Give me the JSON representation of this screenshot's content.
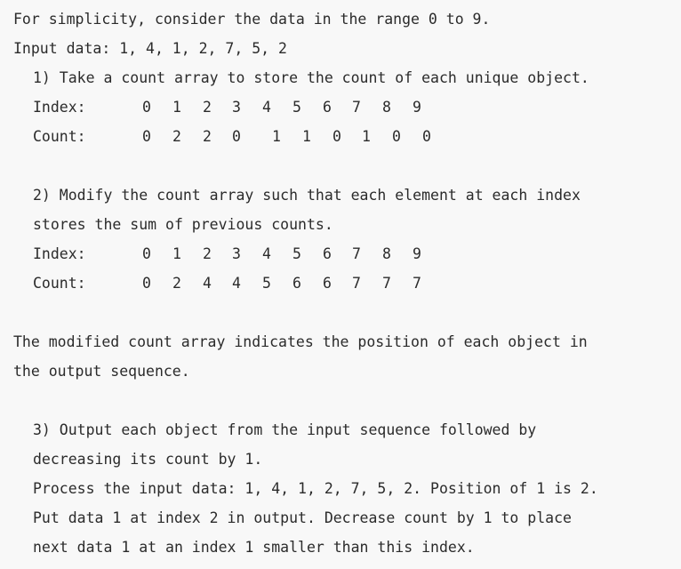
{
  "intro": {
    "line1": "For simplicity, consider the data in the range 0 to 9.",
    "line2": "Input data: 1, 4, 1, 2, 7, 5, 2"
  },
  "step1": {
    "text": "1) Take a count array to store the count of each unique object.",
    "index_label": "Index:",
    "count_label": "Count:",
    "index_values": [
      "0",
      "1",
      "2",
      "3",
      "4",
      "5",
      "6",
      "7",
      "8",
      "9"
    ],
    "count_values": [
      "0",
      "2",
      "2",
      "0",
      "1",
      "1",
      "0",
      "1",
      "0",
      "0"
    ]
  },
  "step2": {
    "text_line1": "2) Modify the count array such that each element at each index",
    "text_line2": "stores the sum of previous counts.",
    "index_label": "Index:",
    "count_label": "Count:",
    "index_values": [
      "0",
      "1",
      "2",
      "3",
      "4",
      "5",
      "6",
      "7",
      "8",
      "9"
    ],
    "count_values": [
      "0",
      "2",
      "4",
      "4",
      "5",
      "6",
      "6",
      "7",
      "7",
      "7"
    ]
  },
  "modified_note": {
    "line1": "The modified count array indicates the position of each object in",
    "line2": "the output sequence."
  },
  "step3": {
    "line1": "3) Output each object from the input sequence followed by",
    "line2": "decreasing its count by 1.",
    "line3": "Process the input data: 1, 4, 1, 2, 7, 5, 2. Position of 1 is 2.",
    "line4": "Put data 1 at index 2 in output. Decrease count by 1 to place",
    "line5": "next data 1 at an index 1 smaller than this index."
  }
}
